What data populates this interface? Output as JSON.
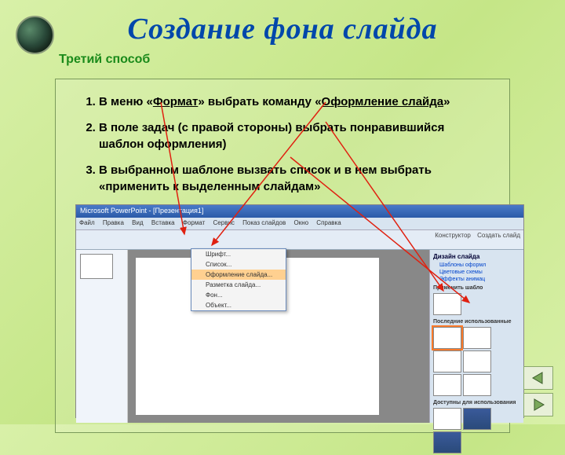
{
  "header": {
    "title": "Создание фона слайда",
    "subtitle": "Третий способ"
  },
  "steps": {
    "s1a": "В меню «",
    "s1b": "Формат",
    "s1c": "» выбрать команду «",
    "s1d": "Оформление слайда",
    "s1e": "»",
    "s2": "В поле задач (с правой стороны) выбрать понравившийся шаблон оформления)",
    "s3": "В выбранном шаблоне вызвать список и в нем выбрать «применить к выделенным слайдам»"
  },
  "screenshot": {
    "title": "Microsoft PowerPoint - [Презентация1]",
    "menubar": {
      "m1": "Файл",
      "m2": "Правка",
      "m3": "Вид",
      "m4": "Вставка",
      "m5": "Формат",
      "m6": "Сервис",
      "m7": "Показ слайдов",
      "m8": "Окно",
      "m9": "Справка"
    },
    "toolbar": {
      "t1": "Конструктор",
      "t2": "Создать слайд"
    },
    "dropdown": {
      "d1": "Шрифт...",
      "d2": "Список...",
      "d3": "Оформление слайда...",
      "d4": "Разметка слайда...",
      "d5": "Фон...",
      "d6": "Объект..."
    },
    "panel": {
      "title": "Дизайн слайда",
      "link1": "Шаблоны оформл",
      "link2": "Цветовые схемы",
      "link3": "Эффекты анимац",
      "section1": "Применить шабло",
      "section2": "Последние использованные",
      "section3": "Доступны для использования"
    }
  }
}
